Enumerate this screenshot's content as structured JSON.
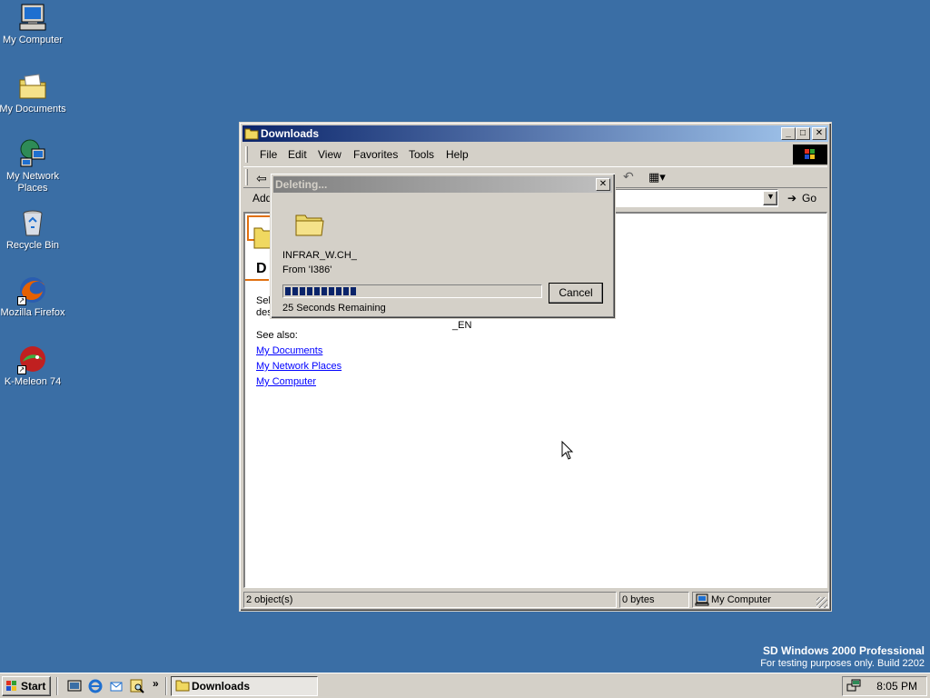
{
  "desktop": {
    "icons": [
      {
        "label": "My Computer"
      },
      {
        "label": "My Documents"
      },
      {
        "label": "My Network Places"
      },
      {
        "label": "Recycle Bin"
      },
      {
        "label": "Mozilla Firefox"
      },
      {
        "label": "K-Meleon 74"
      }
    ],
    "watermark": {
      "line1": "SD Windows 2000 Professional",
      "line2": "For testing purposes only. Build 2202"
    }
  },
  "explorer": {
    "title": "Downloads",
    "menu": [
      "File",
      "Edit",
      "View",
      "Favorites",
      "Tools",
      "Help"
    ],
    "address_label": "Add",
    "go_label": "Go",
    "content": {
      "heading_fragment": "D",
      "select_fragment_1": "Sele",
      "select_fragment_2": "des",
      "en_text": "_EN",
      "see_also": "See also:",
      "links": [
        "My Documents",
        "My Network Places",
        "My Computer"
      ]
    },
    "status": {
      "objects": "2 object(s)",
      "size": "0 bytes",
      "zone": "My Computer"
    }
  },
  "dialog": {
    "title": "Deleting...",
    "file_name": "INFRAR_W.CH_",
    "from": "From 'I386'",
    "time_remaining": "25 Seconds Remaining",
    "progress_fraction": 0.28,
    "cancel_label": "Cancel"
  },
  "taskbar": {
    "start_label": "Start",
    "task_label": "Downloads",
    "clock": "8:05 PM"
  },
  "colors": {
    "desktop": "#3a6ea5",
    "title_active_start": "#0a246a",
    "title_active_end": "#a6caf0",
    "title_inactive_start": "#808080",
    "title_inactive_end": "#c0c0c0",
    "progress": "#0a246a",
    "face": "#d4d0c8"
  }
}
